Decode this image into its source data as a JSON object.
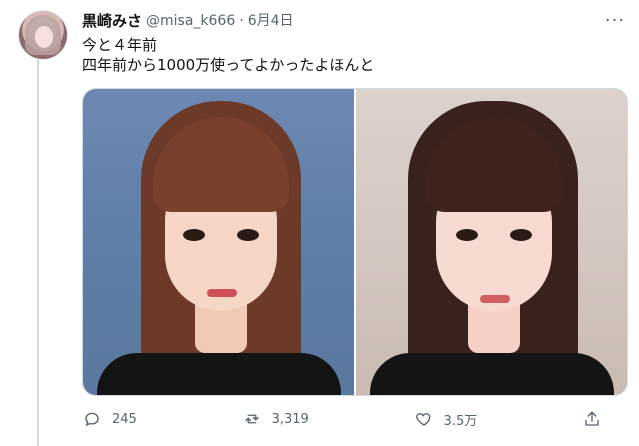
{
  "tweet": {
    "display_name": "黒崎みさ",
    "handle": "@misa_k666",
    "separator": "·",
    "date": "6月4日",
    "text_lines": [
      "今と４年前",
      "四年前から1000万使ってよかったよほんと"
    ],
    "more_glyph": "···"
  },
  "actions": {
    "reply_count": "245",
    "retweet_count": "3,319",
    "like_count": "3.5万"
  },
  "icons": {
    "more": "more-horizontal-icon",
    "reply": "reply-icon",
    "retweet": "retweet-icon",
    "like": "heart-icon",
    "share": "share-icon"
  }
}
